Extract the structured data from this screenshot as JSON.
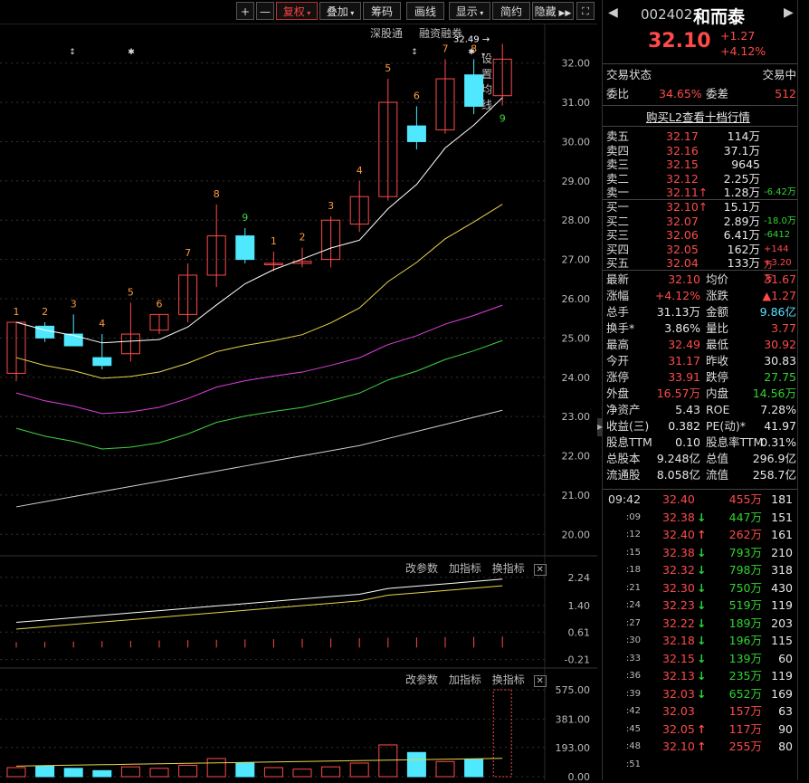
{
  "toolbar": {
    "plus": "+",
    "minus": "—",
    "fuquan": "复权",
    "diejia": "叠加",
    "chouma": "筹码",
    "huaxian": "画线",
    "xianshi": "显示",
    "jiandu": "简约",
    "yincang": "隐藏",
    "sub_links": [
      "深股通",
      "融资融券",
      "设置均线"
    ]
  },
  "quote": {
    "code": "002402",
    "name": "和而泰",
    "price": "32.10",
    "change": "+1.27",
    "pct": "+4.12%"
  },
  "status": {
    "label": "交易状态",
    "value": "交易中"
  },
  "weibi": {
    "label1": "委比",
    "value1": "34.65%",
    "label2": "委差",
    "value2": "512"
  },
  "l2_link": "购买L2查看十档行情",
  "sells": [
    {
      "label": "卖五",
      "price": "32.17",
      "vol": "114万",
      "extra": ""
    },
    {
      "label": "卖四",
      "price": "32.16",
      "vol": "37.1万",
      "extra": ""
    },
    {
      "label": "卖三",
      "price": "32.15",
      "vol": "9645",
      "extra": ""
    },
    {
      "label": "卖二",
      "price": "32.12",
      "vol": "2.25万",
      "extra": ""
    },
    {
      "label": "卖一",
      "price": "32.11↑",
      "vol": "1.28万",
      "extra": "-6.42万"
    }
  ],
  "buys": [
    {
      "label": "买一",
      "price": "32.10↑",
      "vol": "15.1万",
      "extra": ""
    },
    {
      "label": "买二",
      "price": "32.07",
      "vol": "2.89万",
      "extra": "-18.0万"
    },
    {
      "label": "买三",
      "price": "32.06",
      "vol": "6.41万",
      "extra": "-6412"
    },
    {
      "label": "买四",
      "price": "32.05",
      "vol": "162万",
      "extra": "+144万"
    },
    {
      "label": "买五",
      "price": "32.04",
      "vol": "133万",
      "extra": "+3.20万"
    }
  ],
  "stats": [
    {
      "l1": "最新",
      "v1": "32.10",
      "c1": "red",
      "l2": "均价",
      "v2": "31.67",
      "c2": "red"
    },
    {
      "l1": "涨幅",
      "v1": "+4.12%",
      "c1": "red",
      "l2": "涨跌",
      "v2": "▲1.27",
      "c2": "red"
    },
    {
      "l1": "总手",
      "v1": "31.13万",
      "c1": "white",
      "l2": "金额",
      "v2": "9.86亿",
      "c2": "cyan"
    },
    {
      "l1": "换手*",
      "v1": "3.86%",
      "c1": "white",
      "l2": "量比",
      "v2": "3.77",
      "c2": "red"
    },
    {
      "l1": "最高",
      "v1": "32.49",
      "c1": "red",
      "l2": "最低",
      "v2": "30.92",
      "c2": "red"
    },
    {
      "l1": "今开",
      "v1": "31.17",
      "c1": "red",
      "l2": "昨收",
      "v2": "30.83",
      "c2": "white"
    },
    {
      "l1": "涨停",
      "v1": "33.91",
      "c1": "red",
      "l2": "跌停",
      "v2": "27.75",
      "c2": "green"
    },
    {
      "l1": "外盘",
      "v1": "16.57万",
      "c1": "red",
      "l2": "内盘",
      "v2": "14.56万",
      "c2": "green"
    },
    {
      "l1": "净资产",
      "v1": "5.43",
      "c1": "white",
      "l2": "ROE",
      "v2": "7.28%",
      "c2": "white"
    },
    {
      "l1": "收益(三)",
      "v1": "0.382",
      "c1": "white",
      "l2": "PE(动)*",
      "v2": "41.97",
      "c2": "white"
    },
    {
      "l1": "股息TTM",
      "v1": "0.10",
      "c1": "white",
      "l2": "股息率TTM",
      "v2": "0.31%",
      "c2": "white"
    },
    {
      "l1": "总股本",
      "v1": "9.248亿",
      "c1": "white",
      "l2": "总值",
      "v2": "296.9亿",
      "c2": "white"
    },
    {
      "l1": "流通股",
      "v1": "8.058亿",
      "c1": "white",
      "l2": "流值",
      "v2": "258.7亿",
      "c2": "white"
    }
  ],
  "ticks": [
    {
      "time": "09:42",
      "price": "32.40",
      "arrow": "",
      "vol": "455万",
      "n": "181"
    },
    {
      "time": ":09",
      "price": "32.38",
      "arrow": "↓",
      "vol": "447万",
      "n": "151"
    },
    {
      "time": ":12",
      "price": "32.40",
      "arrow": "↑",
      "vol": "262万",
      "n": "161"
    },
    {
      "time": ":15",
      "price": "32.38",
      "arrow": "↓",
      "vol": "793万",
      "n": "210"
    },
    {
      "time": ":18",
      "price": "32.32",
      "arrow": "↓",
      "vol": "798万",
      "n": "318"
    },
    {
      "time": ":21",
      "price": "32.30",
      "arrow": "↓",
      "vol": "750万",
      "n": "430"
    },
    {
      "time": ":24",
      "price": "32.23",
      "arrow": "↓",
      "vol": "519万",
      "n": "119"
    },
    {
      "time": ":27",
      "price": "32.22",
      "arrow": "↓",
      "vol": "189万",
      "n": "203"
    },
    {
      "time": ":30",
      "price": "32.18",
      "arrow": "↓",
      "vol": "196万",
      "n": "115"
    },
    {
      "time": ":33",
      "price": "32.15",
      "arrow": "↓",
      "vol": "139万",
      "n": "60"
    },
    {
      "time": ":36",
      "price": "32.13",
      "arrow": "↓",
      "vol": "235万",
      "n": "119"
    },
    {
      "time": ":39",
      "price": "32.03",
      "arrow": "↓",
      "vol": "652万",
      "n": "169"
    },
    {
      "time": ":42",
      "price": "32.03",
      "arrow": "",
      "vol": "157万",
      "n": "63"
    },
    {
      "time": ":45",
      "price": "32.05",
      "arrow": "↑",
      "vol": "117万",
      "n": "90"
    },
    {
      "time": ":48",
      "price": "32.10",
      "arrow": "↑",
      "vol": "255万",
      "n": "80"
    },
    {
      "time": ":51",
      "price": "",
      "arrow": "",
      "vol": "",
      "n": ""
    }
  ],
  "indicator_buttons": [
    "改参数",
    "加指标",
    "换指标"
  ],
  "chart_data": {
    "type": "candlestick",
    "price_axis": [
      "32.00",
      "31.00",
      "30.00",
      "29.00",
      "28.00",
      "27.00",
      "26.00",
      "25.00",
      "24.00",
      "23.00",
      "22.00",
      "21.00",
      "20.00"
    ],
    "ylim": [
      19.5,
      32.5
    ],
    "candles": [
      {
        "o": 24.1,
        "c": 25.4,
        "h": 25.4,
        "l": 23.9,
        "label": "1"
      },
      {
        "o": 25.3,
        "c": 25.0,
        "h": 25.4,
        "l": 24.9,
        "label": "2"
      },
      {
        "o": 25.1,
        "c": 24.8,
        "h": 25.6,
        "l": 24.8,
        "label": "3"
      },
      {
        "o": 24.5,
        "c": 24.3,
        "h": 25.1,
        "l": 24.2,
        "label": "4"
      },
      {
        "o": 24.6,
        "c": 25.1,
        "h": 25.9,
        "l": 24.4,
        "label": "5"
      },
      {
        "o": 25.2,
        "c": 25.6,
        "h": 25.6,
        "l": 25.1,
        "label": "6"
      },
      {
        "o": 25.6,
        "c": 26.6,
        "h": 26.9,
        "l": 25.4,
        "label": "7"
      },
      {
        "o": 26.6,
        "c": 27.6,
        "h": 28.4,
        "l": 26.3,
        "label": "8"
      },
      {
        "o": 27.6,
        "c": 27.0,
        "h": 27.8,
        "l": 26.9,
        "label": "9"
      },
      {
        "o": 26.9,
        "c": 26.9,
        "h": 27.2,
        "l": 26.7,
        "label": "1"
      },
      {
        "o": 26.9,
        "c": 26.95,
        "h": 27.3,
        "l": 26.8,
        "label": "2"
      },
      {
        "o": 27.0,
        "c": 28.0,
        "h": 28.1,
        "l": 26.8,
        "label": "3"
      },
      {
        "o": 27.9,
        "c": 28.6,
        "h": 29.0,
        "l": 27.7,
        "label": "4"
      },
      {
        "o": 28.6,
        "c": 31.0,
        "h": 31.6,
        "l": 28.5,
        "label": "5"
      },
      {
        "o": 30.4,
        "c": 30.0,
        "h": 30.9,
        "l": 29.8,
        "label": "6"
      },
      {
        "o": 30.3,
        "c": 31.6,
        "h": 32.1,
        "l": 30.2,
        "label": "7"
      },
      {
        "o": 31.7,
        "c": 30.9,
        "h": 32.1,
        "l": 30.7,
        "label": "8"
      },
      {
        "o": 31.17,
        "c": 32.1,
        "h": 32.49,
        "l": 30.92,
        "label": "9"
      }
    ],
    "high_annotation": "32.49",
    "sub1_axis": [
      "2.24",
      "1.40",
      "0.61",
      "-0.21"
    ],
    "sub2_axis": [
      "575.00",
      "381.00",
      "193.00",
      "0.00"
    ],
    "volumes": [
      60,
      70,
      55,
      40,
      65,
      55,
      75,
      120,
      90,
      60,
      50,
      65,
      90,
      210,
      160,
      100,
      115,
      575
    ],
    "colors": {
      "up": "#ff4a4a",
      "down": "#4fe8ff",
      "ma5": "#ffffff",
      "ma10": "#e8d44d",
      "ma20": "#e040e0",
      "ma30": "#3ed43e",
      "ma60": "#cfcfcf"
    }
  }
}
